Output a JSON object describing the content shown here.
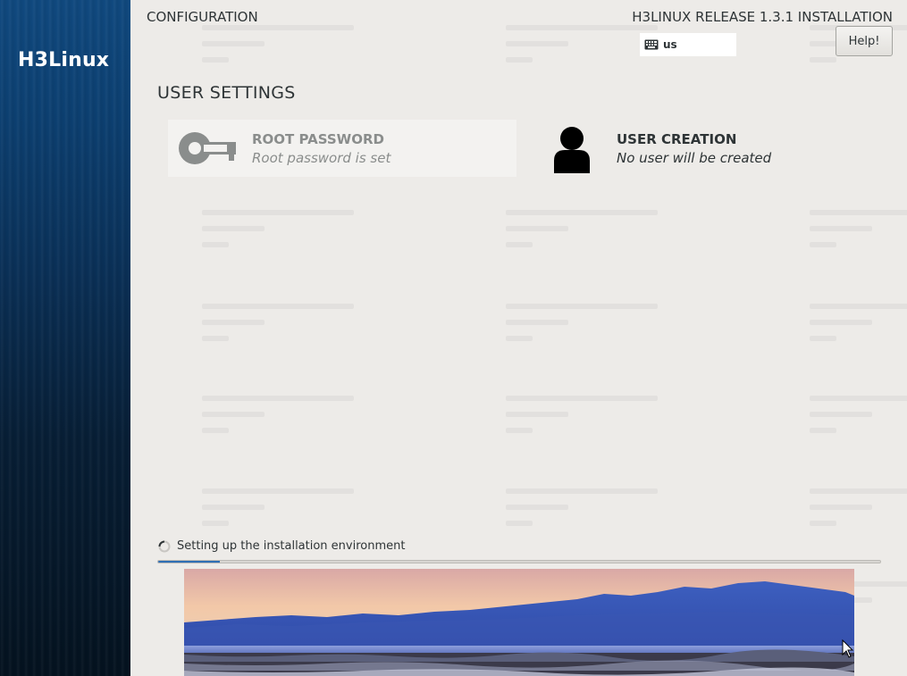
{
  "sidebar": {
    "brand": "H3Linux"
  },
  "header": {
    "title": "CONFIGURATION",
    "release": "H3LINUX RELEASE 1.3.1 INSTALLATION",
    "keyboard_layout": "us",
    "help_label": "Help!"
  },
  "user_settings": {
    "title": "USER SETTINGS",
    "spokes": [
      {
        "title": "ROOT PASSWORD",
        "status": "Root password is set",
        "icon": "key-icon"
      },
      {
        "title": "USER CREATION",
        "status": "No user will be created",
        "icon": "user-icon"
      }
    ]
  },
  "progress": {
    "label": "Setting up the installation environment",
    "fraction": 0.085
  },
  "colors": {
    "accent": "#2f6fb4",
    "background": "#edebe8",
    "text": "#2e3436"
  }
}
